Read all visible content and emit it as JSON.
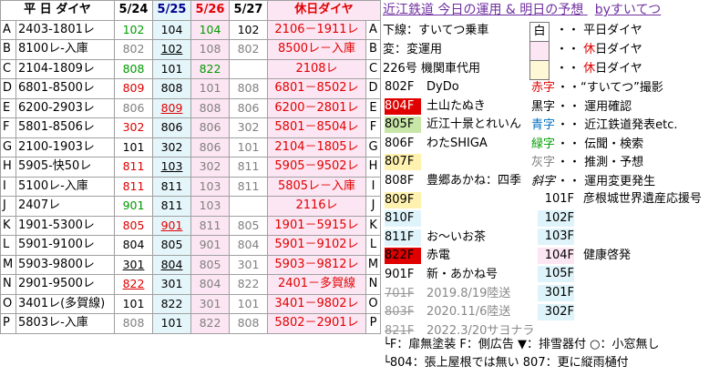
{
  "header": {
    "train_col": "平 日 ダイヤ",
    "d1": "5/24",
    "d2": "5/25",
    "d3": "5/26",
    "d4": "5/27",
    "holiday_col": "休日ダイヤ"
  },
  "rows": [
    {
      "letter": "A",
      "train": "2403-1801レ",
      "d1": "102",
      "d2": "104",
      "d3": "104",
      "d4": "102",
      "holiday": "2106－1911レ",
      "letter2": "A"
    },
    {
      "letter": "B",
      "train": "8100レ-入庫",
      "d1": "802",
      "d2": "102",
      "d3": "108",
      "d4": "802",
      "holiday": "8500レ－入庫",
      "letter2": "B"
    },
    {
      "letter": "C",
      "train": "2104-1809レ",
      "d1": "808",
      "d2": "101",
      "d3": "822",
      "d4": "",
      "holiday": "2108レ",
      "letter2": "C"
    },
    {
      "letter": "D",
      "train": "6801-8500レ",
      "d1": "809",
      "d2": "808",
      "d3": "101",
      "d4": "808",
      "holiday": "6801－8502レ",
      "letter2": "D"
    },
    {
      "letter": "E",
      "train": "6200-2903レ",
      "d1": "806",
      "d2": "809",
      "d3": "808",
      "d4": "806",
      "holiday": "6200－2801レ",
      "letter2": "E"
    },
    {
      "letter": "F",
      "train": "5801-8506レ",
      "d1": "302",
      "d2": "806",
      "d3": "806",
      "d4": "302",
      "holiday": "5801－8504レ",
      "letter2": "F"
    },
    {
      "letter": "G",
      "train": "2100-1903レ",
      "d1": "101",
      "d2": "302",
      "d3": "806",
      "d4": "101",
      "holiday": "2104－1805レ",
      "letter2": "G"
    },
    {
      "letter": "H",
      "train": "5905-快50レ",
      "d1": "811",
      "d2": "103",
      "d3": "302",
      "d4": "811",
      "holiday": "5905－9502レ",
      "letter2": "H"
    },
    {
      "letter": "I",
      "train": "5100レ-入庫",
      "d1": "811",
      "d2": "811",
      "d3": "103",
      "d4": "811",
      "holiday": "5805レ－入庫",
      "letter2": "I"
    },
    {
      "letter": "J",
      "train": "2407レ",
      "d1": "901",
      "d2": "811",
      "d3": "103",
      "d4": "",
      "holiday": "2116レ",
      "letter2": "J"
    },
    {
      "letter": "K",
      "train": "1901-5300レ",
      "d1": "805",
      "d2": "901",
      "d3": "811",
      "d4": "805",
      "holiday": "1901－5915レ",
      "letter2": "K"
    },
    {
      "letter": "L",
      "train": "5901-9100レ",
      "d1": "804",
      "d2": "805",
      "d3": "901",
      "d4": "804",
      "holiday": "5901－9102レ",
      "letter2": "L"
    },
    {
      "letter": "M",
      "train": "5903-9800レ",
      "d1": "301",
      "d2": "804",
      "d3": "805",
      "d4": "301",
      "holiday": "5903－9812レ",
      "letter2": "M"
    },
    {
      "letter": "N",
      "train": "2901-9500レ",
      "d1": "822",
      "d2": "301",
      "d3": "804",
      "d4": "822",
      "holiday": "2401－多賀線",
      "letter2": "N"
    },
    {
      "letter": "O",
      "train": "3401レ(多賀線)",
      "d1": "101",
      "d2": "822",
      "d3": "301",
      "d4": "101",
      "holiday": "3401－9802レ",
      "letter2": "O"
    },
    {
      "letter": "P",
      "train": "5803レ-入庫",
      "d1": "808",
      "d2": "101",
      "d3": "822",
      "d4": "808",
      "holiday": "5802－2901レ",
      "letter2": "P"
    }
  ],
  "side": {
    "title": "近江鉄道 今日の運用 & 明日の予想",
    "by": "byすいてつ",
    "legend_ride": "下線：すいてつ乗車",
    "legend_change": "変：変運用",
    "legend_substitute": "226号 機関車代用",
    "box_weekday": "白",
    "legend_weekday": "・・ 平日ダイヤ",
    "legend_holiday1_dots": "・・",
    "legend_holiday1_red": "休",
    "legend_holiday1": "日ダイヤ",
    "legend_holiday2_dots": "・・",
    "legend_holiday2_red": "休",
    "legend_holiday2": "日ダイヤ",
    "cars_left": [
      {
        "num": "802F",
        "name": "DyDo"
      },
      {
        "num": "804F",
        "name": "土山たぬき"
      },
      {
        "num": "805F",
        "name": "近江十景とれいん"
      },
      {
        "num": "806F",
        "name": "わたSHIGA"
      },
      {
        "num": "807F",
        "name": ""
      },
      {
        "num": "808F",
        "name": "豊郷あかね：四季"
      },
      {
        "num": "809F",
        "name": ""
      },
      {
        "num": "810F",
        "name": ""
      },
      {
        "num": "811F",
        "name": "お～いお茶"
      },
      {
        "num": "822F",
        "name": "赤電"
      },
      {
        "num": "901F",
        "name": "新・あかね号"
      },
      {
        "num": "701F",
        "name": "2019.8/19陸送"
      },
      {
        "num": "803F",
        "name": "2020.11/6陸送"
      },
      {
        "num": "821F",
        "name": "2022.3/20サヨナラ"
      }
    ],
    "colors_legend": [
      {
        "word": "赤字",
        "desc": "・・“すいてつ”撮影",
        "color": "#e00000"
      },
      {
        "word": "黒字",
        "desc": "・・ 運用確認",
        "color": "#000000"
      },
      {
        "word": "青字",
        "desc": "・・ 近江鉄道発表etc.",
        "color": "#0070c0"
      },
      {
        "word": "緑字",
        "desc": "・・ 伝聞・検索",
        "color": "#00a000"
      },
      {
        "word": "灰字",
        "desc": "・・ 推測・予想",
        "color": "#808080"
      },
      {
        "word": "斜字",
        "desc": "・・ 運用変更発生",
        "color": "#000000"
      }
    ],
    "cars_right": [
      {
        "num": "101F",
        "name": "彦根城世界遺産応援号"
      },
      {
        "num": "102F",
        "name": ""
      },
      {
        "num": "103F",
        "name": ""
      },
      {
        "num": "104F",
        "name": "健康啓発"
      },
      {
        "num": "105F",
        "name": ""
      },
      {
        "num": "301F",
        "name": ""
      },
      {
        "num": "302F",
        "name": ""
      }
    ],
    "foot1": "└F：扉無塗装  F：側広告  ▼：排雪器付  ○：小窓無し",
    "foot2": "└804：張上屋根では無い  807：更に縦雨樋付"
  },
  "colors": {
    "pink": "#fde6f3",
    "blue": "#e5f6fb",
    "red": "#e00000",
    "green": "#009a00"
  }
}
